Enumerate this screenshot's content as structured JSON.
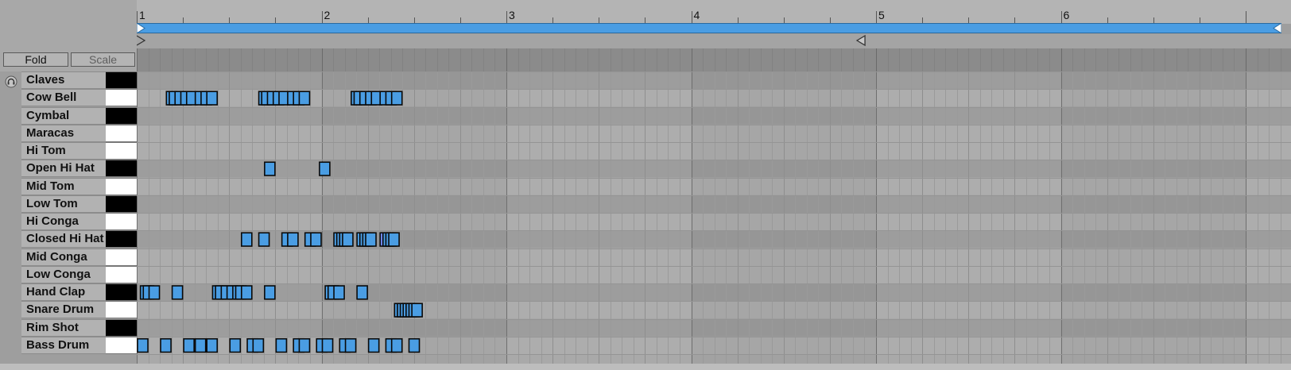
{
  "buttons": {
    "fold_label": "Fold",
    "scale_label": "Scale"
  },
  "ruler": {
    "bars": [
      "1",
      "2",
      "3",
      "4",
      "5",
      "6"
    ]
  },
  "colors": {
    "note_fill": "#4a9de3",
    "note_selected": "#6f87ef",
    "note_border": "#0a0a0a",
    "loop_brace": "#4a9de3"
  },
  "rows": [
    {
      "name": "Claves",
      "key": "black"
    },
    {
      "name": "Cow Bell",
      "key": "white"
    },
    {
      "name": "Cymbal",
      "key": "black"
    },
    {
      "name": "Maracas",
      "key": "white"
    },
    {
      "name": "Hi Tom",
      "key": "white"
    },
    {
      "name": "Open Hi Hat",
      "key": "black"
    },
    {
      "name": "Mid Tom",
      "key": "white"
    },
    {
      "name": "Low Tom",
      "key": "black"
    },
    {
      "name": "Hi Conga",
      "key": "white"
    },
    {
      "name": "Closed Hi Hat",
      "key": "black"
    },
    {
      "name": "Mid Conga",
      "key": "white"
    },
    {
      "name": "Low Conga",
      "key": "white"
    },
    {
      "name": "Hand Clap",
      "key": "black"
    },
    {
      "name": "Snare Drum",
      "key": "white"
    },
    {
      "name": "Rim Shot",
      "key": "black"
    },
    {
      "name": "Bass Drum",
      "key": "white"
    }
  ],
  "notes": {
    "Cow Bell": [
      2.625,
      2.6875,
      2.8125,
      2.9375,
      3.0625,
      3.25,
      3.375,
      3.5,
      4.625,
      4.6875,
      4.8125,
      4.9375,
      5.0625,
      5.25,
      5.375,
      5.5,
      6.625,
      6.6875,
      6.8125,
      6.9375,
      7.0625,
      7.25,
      7.375,
      7.5
    ],
    "Open Hi Hat": [
      4.75,
      5.9375
    ],
    "Closed Hi Hat": [
      4.25,
      4.625,
      5.125,
      5.25,
      5.625,
      5.75,
      6.25,
      6.3125,
      6.375,
      6.4375,
      6.75,
      6.8125,
      6.875,
      6.9375,
      7.25,
      7.3125,
      7.375,
      7.4375
    ],
    "Hand Clap": [
      2.0625,
      2.125,
      2.25,
      2.75,
      3.625,
      3.6875,
      3.8125,
      3.9375,
      4.0625,
      4.125,
      4.25,
      4.75,
      6.0625,
      6.125,
      6.25,
      6.75
    ],
    "Snare Drum": [
      7.5625,
      7.625,
      7.6875,
      7.75,
      7.8125,
      7.875,
      7.9375
    ],
    "Bass Drum": [
      2.0,
      2.5,
      3.0,
      3.25,
      3.5,
      4.0,
      4.375,
      4.5,
      5.0,
      5.375,
      5.5,
      5.875,
      6.0,
      6.375,
      6.5,
      7.0,
      7.375,
      7.5,
      7.875
    ],
    "selected": [
      {
        "row": "Closed Hi Hat",
        "beat": 7.25
      }
    ]
  },
  "timeline": {
    "start_beat": 2.0,
    "beats_per_bar": 4,
    "loop_start_bar": 1,
    "loop_end_bar": 4.94
  }
}
